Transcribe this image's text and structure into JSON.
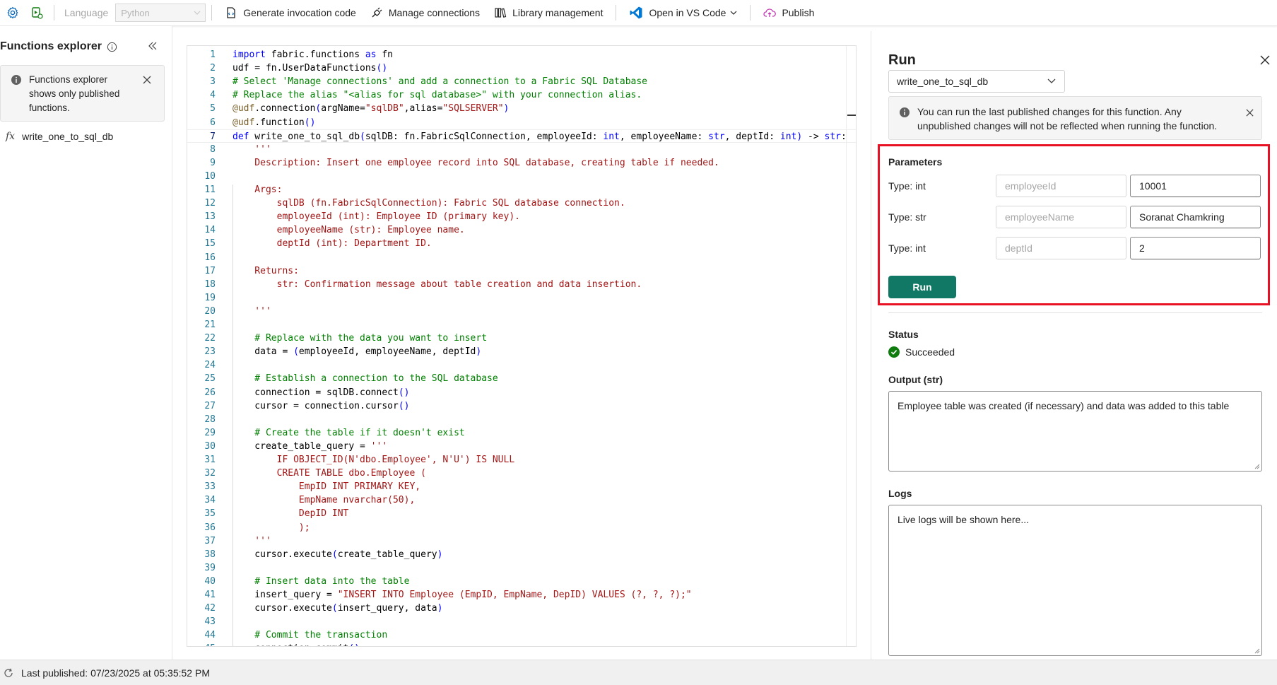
{
  "toolbar": {
    "settings_icon": "gear-icon",
    "test_icon": "flask-run-icon",
    "language_label": "Language",
    "language_value": "Python",
    "generate_label": "Generate invocation code",
    "connections_label": "Manage connections",
    "library_label": "Library management",
    "vscode_label": "Open in VS Code",
    "publish_label": "Publish",
    "vscode_color": "#0078d4",
    "publish_color": "#c239b3"
  },
  "explorer": {
    "title": "Functions explorer",
    "note": "Functions explorer shows only published functions.",
    "functions": [
      {
        "name": "write_one_to_sql_db"
      }
    ]
  },
  "editor": {
    "current_line": 7,
    "lines": [
      "import fabric.functions as fn",
      "udf = fn.UserDataFunctions()",
      "# Select 'Manage connections' and add a connection to a Fabric SQL Database",
      "# Replace the alias \"<alias for sql database>\" with your connection alias.",
      "@udf.connection(argName=\"sqlDB\",alias=\"SQLSERVER\")",
      "@udf.function()",
      "def write_one_to_sql_db(sqlDB: fn.FabricSqlConnection, employeeId: int, employeeName: str, deptId: int) -> str:",
      "    '''",
      "    Description: Insert one employee record into SQL database, creating table if needed.",
      "",
      "    Args:",
      "        sqlDB (fn.FabricSqlConnection): Fabric SQL database connection.",
      "        employeeId (int): Employee ID (primary key).",
      "        employeeName (str): Employee name.",
      "        deptId (int): Department ID.",
      "",
      "    Returns:",
      "        str: Confirmation message about table creation and data insertion.",
      "",
      "    '''",
      "",
      "    # Replace with the data you want to insert",
      "    data = (employeeId, employeeName, deptId)",
      "",
      "    # Establish a connection to the SQL database",
      "    connection = sqlDB.connect()",
      "    cursor = connection.cursor()",
      "",
      "    # Create the table if it doesn't exist",
      "    create_table_query = '''",
      "        IF OBJECT_ID(N'dbo.Employee', N'U') IS NULL",
      "        CREATE TABLE dbo.Employee (",
      "            EmpID INT PRIMARY KEY,",
      "            EmpName nvarchar(50),",
      "            DepID INT",
      "            );",
      "    '''",
      "    cursor.execute(create_table_query)",
      "",
      "    # Insert data into the table",
      "    insert_query = \"INSERT INTO Employee (EmpID, EmpName, DepID) VALUES (?, ?, ?);\"",
      "    cursor.execute(insert_query, data)",
      "",
      "    # Commit the transaction",
      "    connection.commit()"
    ]
  },
  "run": {
    "title": "Run",
    "function_selected": "write_one_to_sql_db",
    "note": "You can run the last published changes for this function. Any unpublished changes will not be reflected when running the function.",
    "parameters_title": "Parameters",
    "parameters": [
      {
        "type": "Type: int",
        "name": "employeeId",
        "value": "10001"
      },
      {
        "type": "Type: str",
        "name": "employeeName",
        "value": "Soranat Chamkring"
      },
      {
        "type": "Type: int",
        "name": "deptId",
        "value": "2"
      }
    ],
    "run_label": "Run",
    "run_color": "#117865",
    "status_label": "Status",
    "status_value": "Succeeded",
    "status_color": "#107c10",
    "output_label": "Output (str)",
    "output_value": "Employee table was created (if necessary) and data was added to this table",
    "logs_label": "Logs",
    "logs_placeholder": "Live logs will be shown here...",
    "highlight_color": "#e81123"
  },
  "footer": {
    "last_published": "Last published: 07/23/2025 at 05:35:52 PM"
  }
}
